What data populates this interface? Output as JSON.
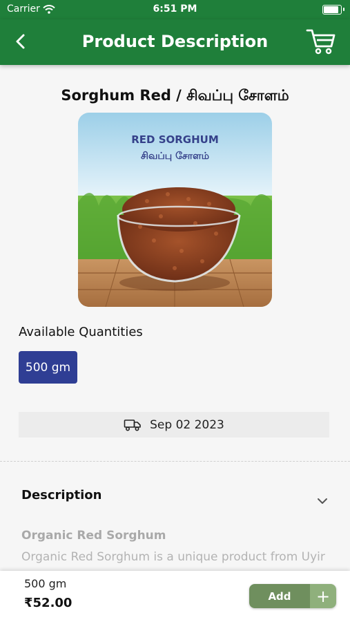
{
  "status": {
    "carrier": "Carrier",
    "time": "6:51 PM"
  },
  "header": {
    "title": "Product Description",
    "back_icon": "chevron-left-icon",
    "cart_icon": "cart-icon"
  },
  "product": {
    "title": "Sorghum Red / சிவப்பு சோளம்",
    "image_label_en": "RED SORGHUM",
    "image_label_ta": "சிவப்பு சோளம்"
  },
  "quantities": {
    "label": "Available Quantities",
    "options": [
      "500 gm"
    ],
    "selected": "500 gm"
  },
  "delivery": {
    "icon": "truck-icon",
    "date": "Sep 02 2023"
  },
  "description": {
    "heading": "Description",
    "subtitle": "Organic Red Sorghum",
    "text": "Organic Red Sorghum is a unique product from Uyir"
  },
  "cart_bar": {
    "quantity": "500 gm",
    "price": "₹52.00",
    "add_label": "Add",
    "plus_label": "+"
  },
  "colors": {
    "primary_green": "#1f7f3a",
    "chip_blue": "#2f3e94",
    "add_green": "#6f8f5e"
  }
}
